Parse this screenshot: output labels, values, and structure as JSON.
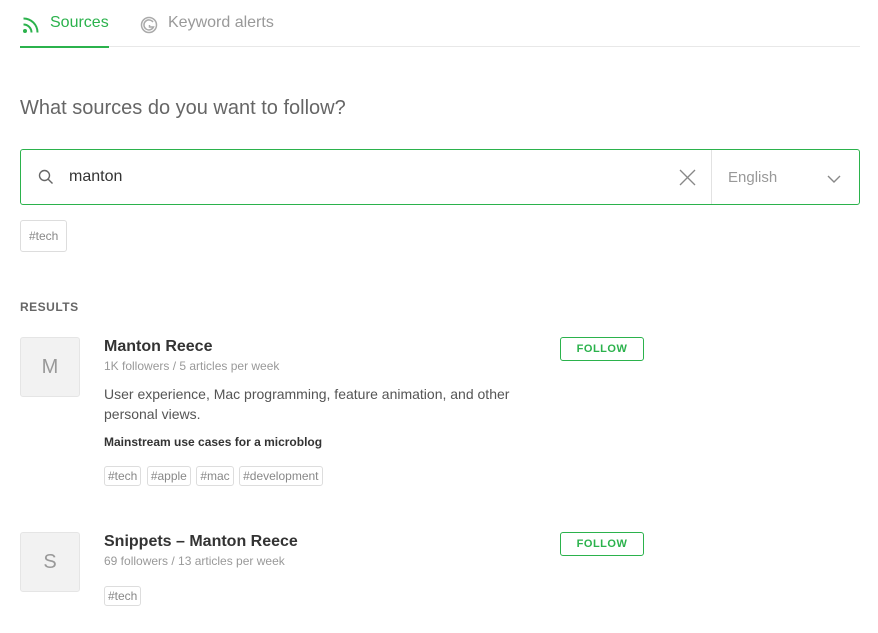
{
  "tabs": [
    {
      "label": "Sources",
      "icon": "rss-icon",
      "active": true
    },
    {
      "label": "Keyword alerts",
      "icon": "google-icon",
      "active": false
    }
  ],
  "question": "What sources do you want to follow?",
  "search": {
    "value": "manton",
    "placeholder": ""
  },
  "language": {
    "selected": "English"
  },
  "query_tags": [
    "#tech"
  ],
  "results_label": "RESULTS",
  "results": [
    {
      "initial": "M",
      "name": "Manton Reece",
      "stats": "1K followers / 5 articles per week",
      "description": "User experience, Mac programming, feature animation, and other personal views.",
      "article": "Mainstream use cases for a microblog",
      "tags": [
        "#tech",
        "#apple",
        "#mac",
        "#development"
      ],
      "follow_label": "FOLLOW"
    },
    {
      "initial": "S",
      "name": "Snippets – Manton Reece",
      "stats": "69 followers / 13 articles per week",
      "tags": [
        "#tech"
      ],
      "follow_label": "FOLLOW"
    }
  ],
  "colors": {
    "accent": "#2bb24c",
    "muted": "#999999"
  }
}
